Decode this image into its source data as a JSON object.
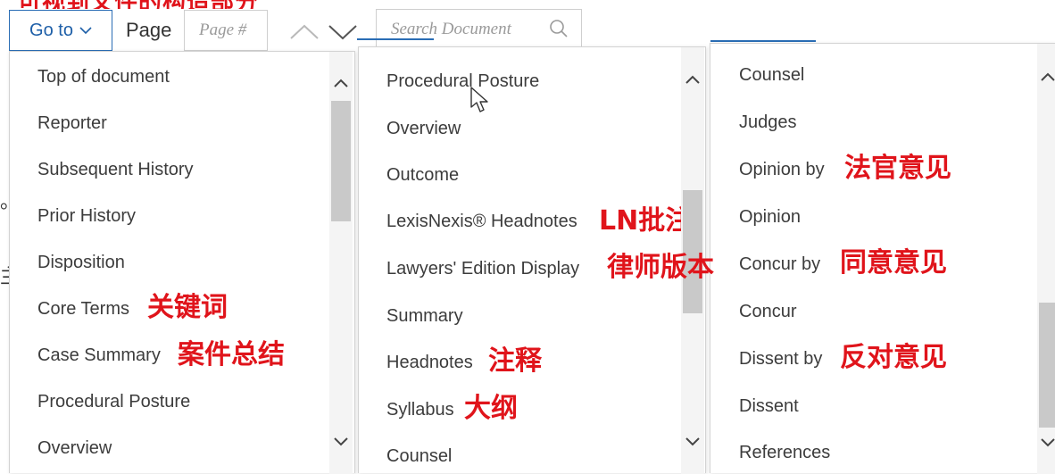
{
  "heading_annotation_cut": "可视到文件的构造部分",
  "toolbar": {
    "goto_label": "Go to",
    "page_label": "Page",
    "page_placeholder": "Page #",
    "search_placeholder": "Search Document"
  },
  "panel1": {
    "items": [
      {
        "label": "Top of document"
      },
      {
        "label": "Reporter"
      },
      {
        "label": "Subsequent History"
      },
      {
        "label": "Prior History"
      },
      {
        "label": "Disposition"
      },
      {
        "label": "Core Terms",
        "note": "关键词"
      },
      {
        "label": "Case Summary",
        "note": "案件总结"
      },
      {
        "label": "Procedural Posture"
      },
      {
        "label": "Overview"
      }
    ]
  },
  "panel2": {
    "items": [
      {
        "label": "Procedural Posture"
      },
      {
        "label": "Overview"
      },
      {
        "label": "Outcome"
      },
      {
        "label": "LexisNexis® Headnotes",
        "note": "LN批注"
      },
      {
        "label": "Lawyers' Edition Display",
        "note": "律师版本"
      },
      {
        "label": "Summary"
      },
      {
        "label": "Headnotes",
        "note": "注释"
      },
      {
        "label": "Syllabus",
        "note": "大纲"
      },
      {
        "label": "Counsel"
      }
    ]
  },
  "panel3": {
    "items": [
      {
        "label": "Counsel"
      },
      {
        "label": "Judges"
      },
      {
        "label": "Opinion by",
        "note": "法官意见"
      },
      {
        "label": "Opinion"
      },
      {
        "label": "Concur by",
        "note": "同意意见"
      },
      {
        "label": "Concur"
      },
      {
        "label": "Dissent by",
        "note": "反对意见"
      },
      {
        "label": "Dissent"
      },
      {
        "label": "References"
      }
    ]
  },
  "background_glyphs": {
    "left_a": "。",
    "left_b": "主"
  },
  "colors": {
    "accent": "#2a6db5",
    "annotation": "#e0141b",
    "scroll_thumb": "#c9c9c9"
  }
}
